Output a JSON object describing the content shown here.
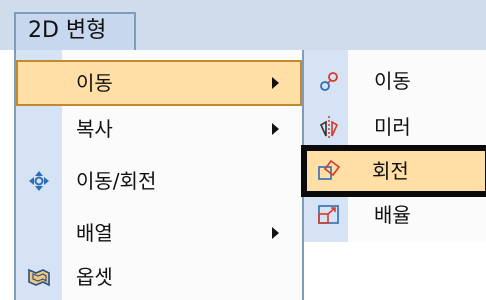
{
  "menubar": {
    "item_label": "2D 변형"
  },
  "menu": {
    "items": [
      {
        "label": "이동",
        "has_submenu": true,
        "highlighted": true,
        "icon": ""
      },
      {
        "label": "복사",
        "has_submenu": true,
        "highlighted": false,
        "icon": ""
      },
      {
        "label": "이동/회전",
        "has_submenu": false,
        "highlighted": false,
        "icon": "move-rotate-icon"
      },
      {
        "label": "배열",
        "has_submenu": true,
        "highlighted": false,
        "icon": ""
      },
      {
        "label": "옵셋",
        "has_submenu": false,
        "highlighted": false,
        "icon": "offset-icon"
      }
    ]
  },
  "submenu": {
    "items": [
      {
        "label": "이동",
        "icon": "move-icon",
        "highlighted": false
      },
      {
        "label": "미러",
        "icon": "mirror-icon",
        "highlighted": false
      },
      {
        "label": "회전",
        "icon": "rotate-icon",
        "highlighted": true
      },
      {
        "label": "배율",
        "icon": "scale-icon",
        "highlighted": false
      }
    ]
  },
  "colors": {
    "highlight_fill": "#ffdfa6",
    "highlight_border": "#c28a30",
    "gutter": "#d6e3f4",
    "menubar": "#cfdcec"
  }
}
